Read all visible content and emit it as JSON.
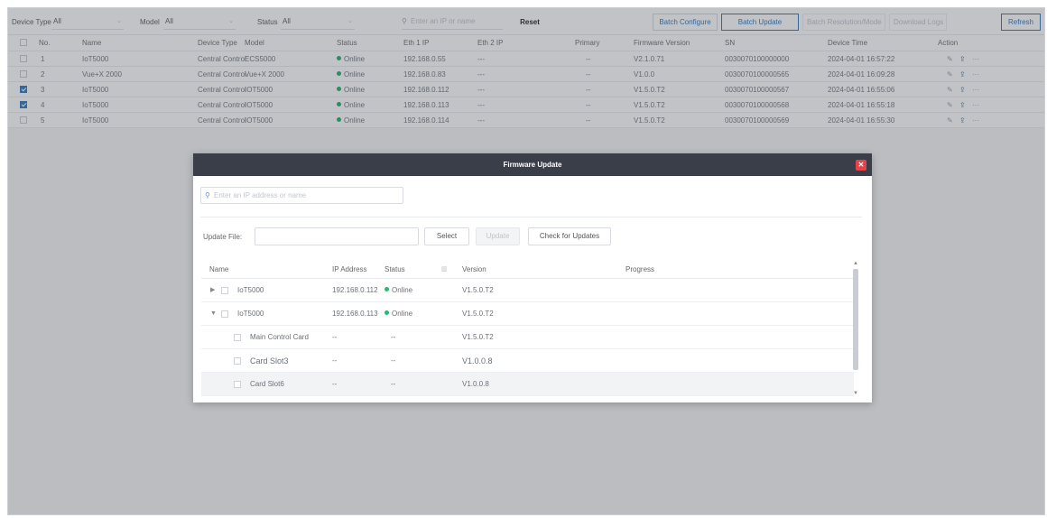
{
  "filters": {
    "device_type_label": "Device Type",
    "device_type_value": "All",
    "model_label": "Model",
    "model_value": "All",
    "status_label": "Status",
    "status_value": "All",
    "search_placeholder": "Enter an IP or name",
    "reset_label": "Reset"
  },
  "toolbar": {
    "batch_configure": "Batch Configure",
    "batch_update": "Batch Update",
    "batch_disabled_1": "Batch Resolution/Mode",
    "batch_disabled_2": "Download Logs",
    "refresh": "Refresh"
  },
  "table": {
    "headers": {
      "no": "No.",
      "name": "Name",
      "device_type": "Device Type",
      "model": "Model",
      "status": "Status",
      "eth1": "Eth 1 IP",
      "eth2": "Eth 2 IP",
      "primary": "Primary",
      "firmware": "Firmware Version",
      "sn": "SN",
      "device_time": "Device Time",
      "action": "Action"
    },
    "rows": [
      {
        "no": "1",
        "name": "IoT5000",
        "type": "Central Control",
        "model": "ECS5000",
        "status": "Online",
        "eth1": "192.168.0.55",
        "eth2": "---",
        "primary": "--",
        "firmware": "V2.1.0.71",
        "sn": "0030070100000000",
        "time": "2024-04-01 16:57:22",
        "checked": false
      },
      {
        "no": "2",
        "name": "Vue+X 2000",
        "type": "Central Control",
        "model": "Vue+X 2000",
        "status": "Online",
        "eth1": "192.168.0.83",
        "eth2": "---",
        "primary": "--",
        "firmware": "V1.0.0",
        "sn": "0030070100000565",
        "time": "2024-04-01 16:09:28",
        "checked": false
      },
      {
        "no": "3",
        "name": "IoT5000",
        "type": "Central Control",
        "model": "IOT5000",
        "status": "Online",
        "eth1": "192.168.0.112",
        "eth2": "---",
        "primary": "--",
        "firmware": "V1.5.0.T2",
        "sn": "0030070100000567",
        "time": "2024-04-01 16:55:06",
        "checked": true
      },
      {
        "no": "4",
        "name": "IoT5000",
        "type": "Central Control",
        "model": "IOT5000",
        "status": "Online",
        "eth1": "192.168.0.113",
        "eth2": "---",
        "primary": "--",
        "firmware": "V1.5.0.T2",
        "sn": "0030070100000568",
        "time": "2024-04-01 16:55:18",
        "checked": true
      },
      {
        "no": "5",
        "name": "IoT5000",
        "type": "Central Control",
        "model": "IOT5000",
        "status": "Online",
        "eth1": "192.168.0.114",
        "eth2": "---",
        "primary": "--",
        "firmware": "V1.5.0.T2",
        "sn": "0030070100000569",
        "time": "2024-04-01 16:55:30",
        "checked": false
      }
    ]
  },
  "dialog": {
    "title": "Firmware Update",
    "search_placeholder": "Enter an IP address or name",
    "update_file_label": "Update File:",
    "select_label": "Select",
    "update_label": "Update",
    "check_label": "Check for Updates",
    "headers": {
      "name": "Name",
      "ip": "IP Address",
      "status": "Status",
      "version": "Version",
      "progress": "Progress"
    },
    "rows": [
      {
        "expander": "▶",
        "name": "IoT5000",
        "ip": "192.168.0.112",
        "status": "Online",
        "version": "V1.5.0.T2"
      },
      {
        "expander": "▼",
        "name": "IoT5000",
        "ip": "192.168.0.113",
        "status": "Online",
        "version": "V1.5.0.T2"
      },
      {
        "name": "Main Control Card",
        "ip": "--",
        "status": "--",
        "version": "V1.5.0.T2"
      },
      {
        "name": "Card Slot3",
        "ip": "--",
        "status": "--",
        "version": "V1.0.0.8"
      },
      {
        "name": "Card Slot6",
        "ip": "--",
        "status": "--",
        "version": "V1.0.0.8"
      }
    ]
  },
  "colors": {
    "accent": "#3b82c4",
    "online": "#2bb673",
    "dialog_header": "#393e49",
    "close": "#e0454c"
  }
}
